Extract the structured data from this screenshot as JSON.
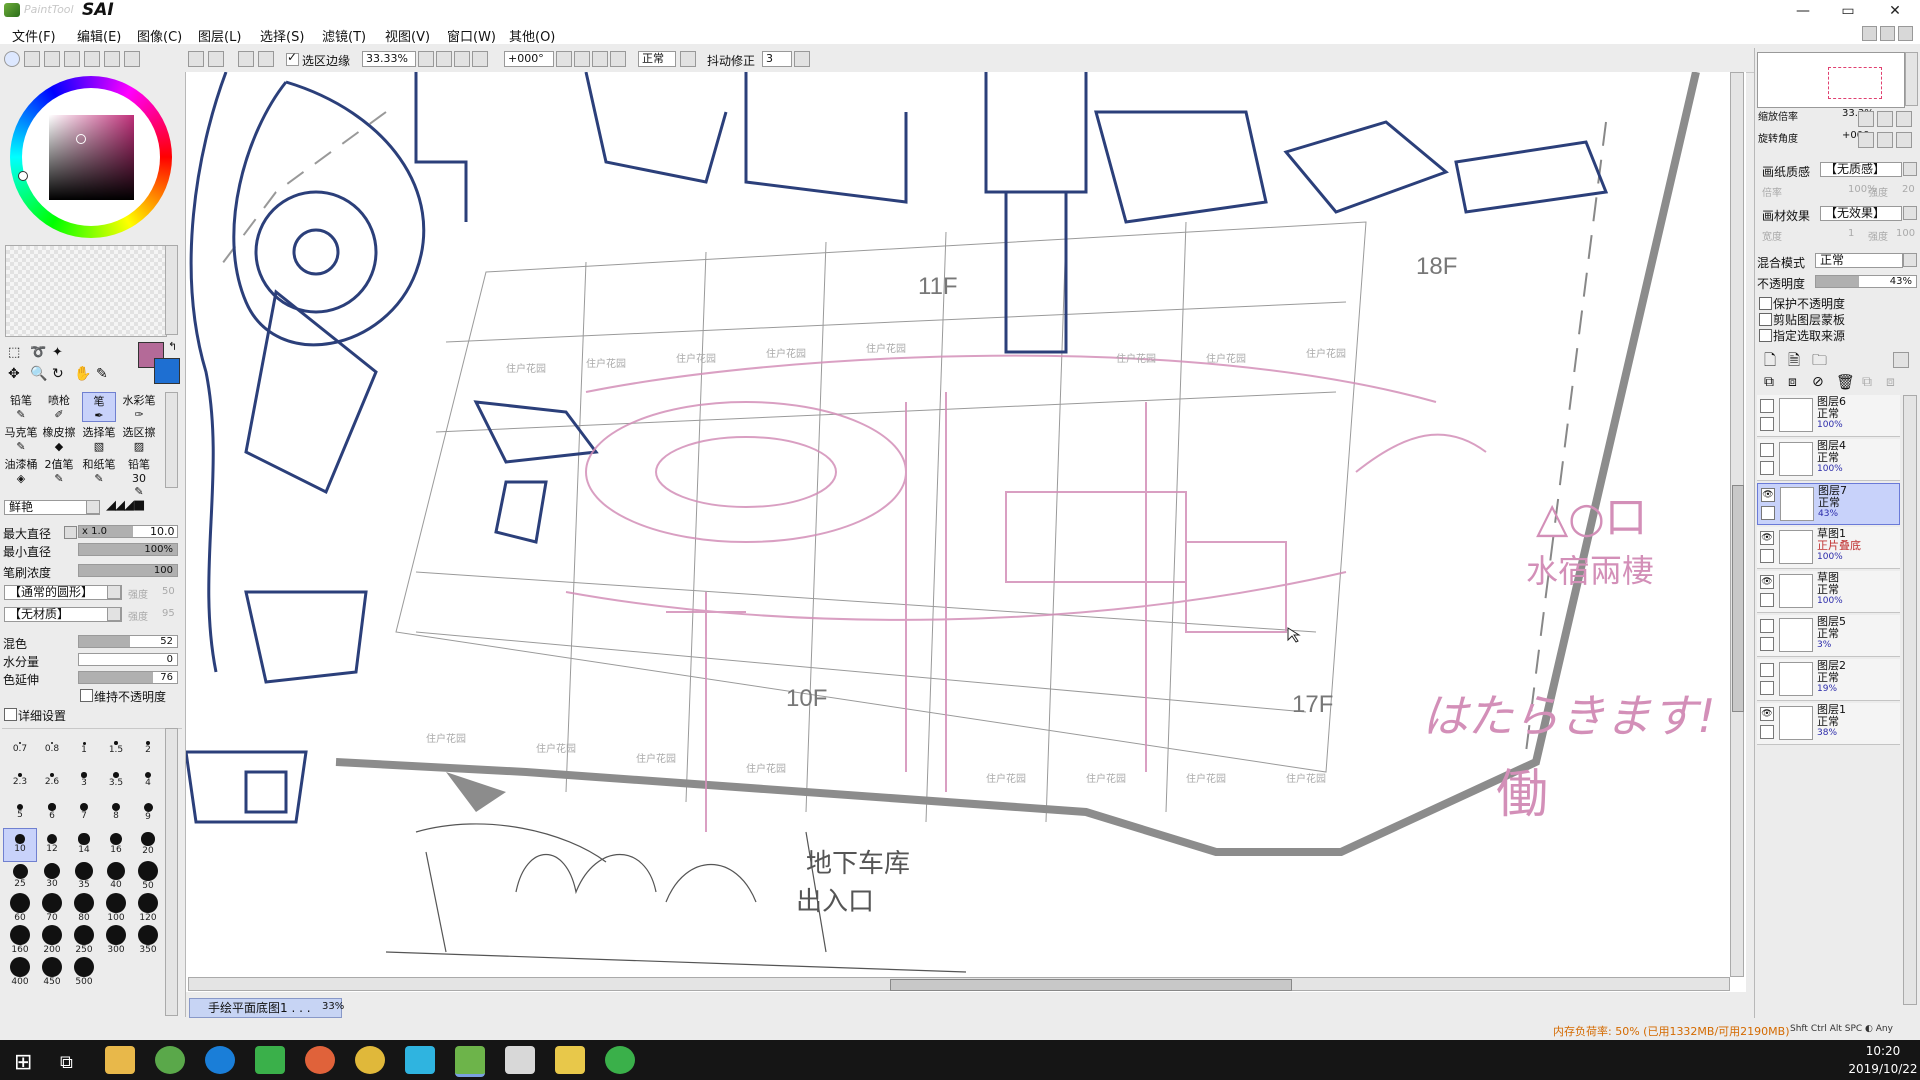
{
  "window": {
    "title_faded": "PaintTool",
    "title": "SAI",
    "controls": [
      "—",
      "▭",
      "✕"
    ]
  },
  "menu": [
    "文件(F)",
    "编辑(E)",
    "图像(C)",
    "图层(L)",
    "选择(S)",
    "滤镜(T)",
    "视图(V)",
    "窗口(W)",
    "其他(O)"
  ],
  "toolbar": {
    "selection_edge_label": "选区边缘",
    "zoom": "33.33%",
    "rotation": "+000°",
    "blend": "正常",
    "stabilizer_label": "抖动修正",
    "stabilizer_value": "3"
  },
  "tools": {
    "row1": [
      "铅笔",
      "喷枪",
      "笔",
      "水彩笔"
    ],
    "row2": [
      "马克笔",
      "橡皮擦",
      "选择笔",
      "选区擦"
    ],
    "row3": [
      "油漆桶",
      "2值笔",
      "和纸笔",
      "铅笔30"
    ]
  },
  "brush": {
    "edge_label": "鲜艳",
    "max_size_label": "最大直径",
    "max_size_mult": "x 1.0",
    "max_size_value": "10.0",
    "max_size_level": 0.55,
    "min_size_label": "最小直径",
    "min_size_value": "100%",
    "min_size_level": 1.0,
    "density_label": "笔刷浓度",
    "density_value": "100",
    "density_level": 1.0,
    "shape_label": "【通常的圆形】",
    "shape_strength": "强度",
    "shape_strength_value": "50",
    "texture_label": "【无材质】",
    "texture_strength": "强度",
    "texture_strength_value": "95",
    "blend_label": "混色",
    "blend_value": "52",
    "blend_level": 0.52,
    "water_label": "水分量",
    "water_value": "0",
    "water_level": 0.0,
    "persist_label": "色延伸",
    "persist_value": "76",
    "persist_level": 0.76,
    "keep_opacity_label": "维持不透明度",
    "detail_label": "详细设置"
  },
  "brush_sizes": [
    "0.7",
    "0.8",
    "1",
    "1.5",
    "2",
    "2.3",
    "2.6",
    "3",
    "3.5",
    "4",
    "5",
    "6",
    "7",
    "8",
    "9",
    "10",
    "12",
    "14",
    "16",
    "20",
    "25",
    "30",
    "35",
    "40",
    "50",
    "60",
    "70",
    "80",
    "100",
    "120",
    "160",
    "200",
    "250",
    "300",
    "350",
    "400",
    "450",
    "500"
  ],
  "navigator": {
    "zoom_label": "缩放倍率",
    "zoom_value": "33.3%",
    "angle_label": "旋转角度",
    "angle_value": "+000"
  },
  "paper": {
    "texture_label": "画纸质感",
    "texture_value": "【无质感】",
    "scale_label": "倍率",
    "scale_value": "100%",
    "strength_label": "强度",
    "strength_value": "20",
    "effect_label": "画材效果",
    "effect_value": "【无效果】",
    "width_label": "宽度",
    "width_value": "1",
    "effect_strength_label": "强度",
    "effect_strength_value": "100"
  },
  "layer_props": {
    "blend_label": "混合模式",
    "blend_value": "正常",
    "opacity_label": "不透明度",
    "opacity_value": "43%",
    "opacity_level": 0.43,
    "protect_label": "保护不透明度",
    "clip_label": "剪贴图层蒙板",
    "source_label": "指定选取来源"
  },
  "layers": [
    {
      "name": "图层6",
      "mode": "正常",
      "opacity": "100%",
      "visible": false,
      "selected": false
    },
    {
      "name": "图层4",
      "mode": "正常",
      "opacity": "100%",
      "visible": false,
      "selected": false
    },
    {
      "name": "图层7",
      "mode": "正常",
      "opacity": "43%",
      "visible": true,
      "selected": true
    },
    {
      "name": "草图1",
      "mode": "正片叠底",
      "opacity": "100%",
      "visible": true,
      "selected": false
    },
    {
      "name": "草图",
      "mode": "正常",
      "opacity": "100%",
      "visible": true,
      "selected": false
    },
    {
      "name": "图层5",
      "mode": "正常",
      "opacity": "3%",
      "visible": false,
      "selected": false
    },
    {
      "name": "图层2",
      "mode": "正常",
      "opacity": "19%",
      "visible": false,
      "selected": false
    },
    {
      "name": "图层1",
      "mode": "正常",
      "opacity": "38%",
      "visible": true,
      "selected": false
    }
  ],
  "canvas_labels": {
    "floor_11": "11F",
    "floor_18": "18F",
    "floor_10": "10F",
    "floor_17": "17F",
    "garage_1": "地下车库",
    "garage_2": "出入口",
    "note_shapes": "△○口",
    "note_1": "水宿兩棲",
    "note_2": "はたらきます!",
    "note_3": "働",
    "garden": "住户花园"
  },
  "document_tab": {
    "name": "手绘平面底图1 . . .",
    "zoom": "33%"
  },
  "status": {
    "memory": "内存负荷率: 50% (已用1332MB/可用2190MB)",
    "keys": "Shft Ctrl Alt SPC ◐ Any"
  },
  "clock": {
    "time": "10:20",
    "date": "2019/10/22"
  },
  "colors": {
    "primary": "#b46a98",
    "secondary": "#1e6fd2",
    "sketch_blue": "#2b3f7a",
    "sketch_pink": "#d38fb8",
    "selected_layer": "#c8d2fa"
  }
}
